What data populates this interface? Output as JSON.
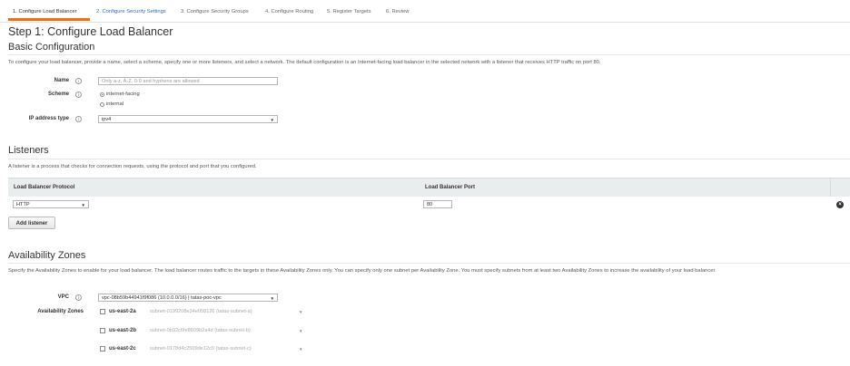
{
  "tabs": [
    {
      "label": "1. Configure Load Balancer"
    },
    {
      "label": "2. Configure Security Settings"
    },
    {
      "label": "3. Configure Security Groups"
    },
    {
      "label": "4. Configure Routing"
    },
    {
      "label": "5. Register Targets"
    },
    {
      "label": "6. Review"
    }
  ],
  "page_title": "Step 1: Configure Load Balancer",
  "basic": {
    "heading": "Basic Configuration",
    "description": "To configure your load balancer, provide a name, select a scheme, specify one or more listeners, and select a network. The default configuration is an Internet-facing load balancer in the selected network with a listener that receives HTTP traffic on port 80.",
    "name_label": "Name",
    "name_placeholder": "Only a-z, A-Z, 0-9 and hyphens are allowed",
    "scheme_label": "Scheme",
    "scheme_options": [
      "internet-facing",
      "internal"
    ],
    "ip_label": "IP address type",
    "ip_value": "ipv4"
  },
  "listeners": {
    "heading": "Listeners",
    "description": "A listener is a process that checks for connection requests, using the protocol and port that you configured.",
    "col_protocol": "Load Balancer Protocol",
    "col_port": "Load Balancer Port",
    "protocol_value": "HTTP",
    "port_value": "80",
    "add_button": "Add listener"
  },
  "az": {
    "heading": "Availability Zones",
    "description": "Specify the Availability Zones to enable for your load balancer. The load balancer routes traffic to the targets in these Availability Zones only. You can specify only one subnet per Availability Zone. You must specify subnets from at least two Availability Zones to increase the availability of your load balancer.",
    "vpc_label": "VPC",
    "vpc_value": "vpc-08b59b44941f9f086 (10.0.0.0/16) | tatas-poc-vpc",
    "zones_label": "Availability Zones",
    "zones": [
      {
        "name": "us-east-2a",
        "subnet": "subnet-0199208e34e058126 (tatas-subnet-a)"
      },
      {
        "name": "us-east-2b",
        "subnet": "subnet-0b92c6fe8609b2a4d (tatas-subnet-b)"
      },
      {
        "name": "us-east-2c",
        "subnet": "subnet-0178d4c2509de12c0 (tatas-subnet-c)"
      }
    ]
  },
  "icons": {
    "info": "i",
    "dropdown": "▼",
    "close": "×"
  },
  "colors": {
    "accent": "#ec7211",
    "link": "#2a6ebb",
    "header_bg": "#eaeded"
  }
}
